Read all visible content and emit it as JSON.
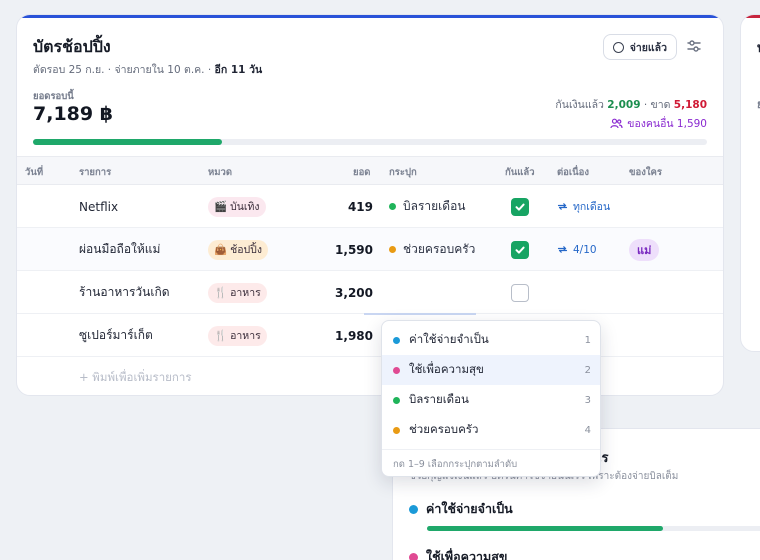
{
  "card": {
    "title": "บัตรช้อปปิ้ง",
    "subtitle": "ตัดรอบ 25 ก.ย. · จ่ายภายใน 10 ต.ค. ·",
    "due_in": "อีก 11 วัน",
    "paid_button": "จ่ายแล้ว",
    "balance_label": "ยอดรอบนี้",
    "balance_value": "7,189 ฿",
    "paid_label": "กันเงินแล้ว",
    "paid_amount": "2,009",
    "short_label": "· ขาด",
    "short_amount": "5,180",
    "others_text": "ของคนอื่น 1,590",
    "progress_fraction": 0.28,
    "accent": "#2952d8"
  },
  "table": {
    "headers": {
      "day": "วันที่",
      "item": "รายการ",
      "category": "หมวด",
      "amount": "ยอด",
      "bucket": "กระปุก",
      "reserved": "กันแล้ว",
      "repeat": "ต่อเนื่อง",
      "owner": "ของใคร"
    },
    "rows": [
      {
        "name": "Netflix",
        "category": "บันเทิง",
        "category_icon": "clapperboard-icon",
        "amount": "419",
        "bucket": "บิลรายเดือน",
        "bucket_color": "#1fb45a",
        "reserved": true,
        "repeat": "ทุกเดือน",
        "owner": ""
      },
      {
        "name": "ผ่อนมือถือให้แม่",
        "category": "ช้อปปิ้ง",
        "category_icon": "shopping-bag-icon",
        "amount": "1,590",
        "bucket": "ช่วยครอบครัว",
        "bucket_color": "#e99b14",
        "reserved": true,
        "repeat": "4/10",
        "owner": "แม่"
      },
      {
        "name": "ร้านอาหารวันเกิด",
        "category": "อาหาร",
        "category_icon": "fork-knife-icon",
        "amount": "3,200",
        "bucket": "",
        "bucket_color": "",
        "reserved": false,
        "repeat": "",
        "owner": ""
      },
      {
        "name": "ซูเปอร์มาร์เก็ต",
        "category": "อาหาร",
        "category_icon": "fork-knife-icon",
        "amount": "1,980",
        "bucket": "",
        "bucket_color": "",
        "reserved": false,
        "repeat": "",
        "owner": ""
      }
    ],
    "add_placeholder": "+ พิมพ์เพื่อเพิ่มรายการ"
  },
  "dropdown": {
    "items": [
      {
        "label": "ค่าใช้จ่ายจำเป็น",
        "key": "1",
        "color": "#1b9ad8"
      },
      {
        "label": "ใช้เพื่อความสุข",
        "key": "2",
        "color": "#e04a93",
        "selected": true
      },
      {
        "label": "บิลรายเดือน",
        "key": "3",
        "color": "#1fb45a"
      },
      {
        "label": "ช่วยครอบครัว",
        "key": "4",
        "color": "#e99b14"
      }
    ],
    "hint": "กด 1–9 เลือกกระปุกตามลำดับ"
  },
  "bg_panel": {
    "title_fragment": "ไร",
    "subtitle_fragment": "ช่วยกุญแจเงินแล้ว บัตรนี้ค่าใช้จ่ายนั้นเร็ว เพราะต้องจ่ายบิลเต็ม",
    "item1": "ค่าใช้จ่ายจำเป็น",
    "item2": "ใช้เพื่อความสุข",
    "bar_fraction": 0.62
  },
  "right_card": {
    "fragment1": "บ",
    "fragment2": "ย",
    "accent": "#c7253e"
  }
}
